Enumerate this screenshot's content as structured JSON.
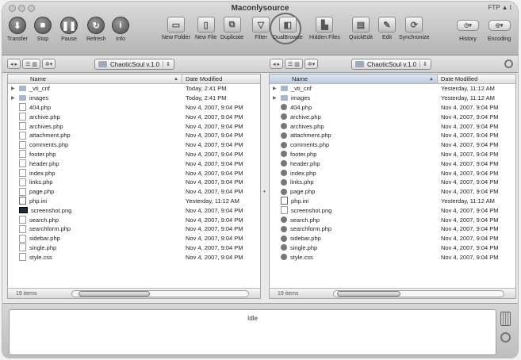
{
  "window": {
    "title": "Maconlysource",
    "ftp_badge": "FTP ▲ t"
  },
  "toolbar": {
    "transfer": "Transfer",
    "stop": "Stop",
    "pause": "Pause",
    "refresh": "Refresh",
    "info": "Info",
    "new_folder": "New Folder",
    "new_file": "New File",
    "duplicate": "Duplicate",
    "filter": "Filter",
    "dual_browse": "DualBrowse",
    "hidden_files": "Hidden Files",
    "quickedit": "QuickEdit",
    "edit": "Edit",
    "synchronize": "Synchronize",
    "history": "History",
    "encoding": "Encoding"
  },
  "icons": {
    "transfer": "down-arrow-icon",
    "stop": "stop-icon",
    "pause": "pause-icon",
    "refresh": "refresh-icon",
    "info": "info-icon",
    "new_folder": "new-folder-icon",
    "new_file": "new-file-icon",
    "duplicate": "duplicate-icon",
    "filter": "filter-icon",
    "dual_browse": "dual-browse-icon",
    "hidden_files": "hidden-files-icon",
    "quickedit": "quickedit-icon",
    "edit": "edit-icon",
    "synchronize": "synchronize-icon"
  },
  "left": {
    "path": "ChaoticSoul v.1.0",
    "header": {
      "name": "Name",
      "date": "Date Modified"
    },
    "items_count": "19 items",
    "rows": [
      {
        "name": "_vti_cnf",
        "date": "Today, 2:41 PM",
        "kind": "folder"
      },
      {
        "name": "images",
        "date": "Today, 2:41 PM",
        "kind": "folder"
      },
      {
        "name": "404.php",
        "date": "Nov 4, 2007, 9:04 PM",
        "kind": "php"
      },
      {
        "name": "archive.php",
        "date": "Nov 4, 2007, 9:04 PM",
        "kind": "php"
      },
      {
        "name": "archives.php",
        "date": "Nov 4, 2007, 9:04 PM",
        "kind": "php"
      },
      {
        "name": "attachment.php",
        "date": "Nov 4, 2007, 9:04 PM",
        "kind": "php"
      },
      {
        "name": "comments.php",
        "date": "Nov 4, 2007, 9:04 PM",
        "kind": "php"
      },
      {
        "name": "footer.php",
        "date": "Nov 4, 2007, 9:04 PM",
        "kind": "php"
      },
      {
        "name": "header.php",
        "date": "Nov 4, 2007, 9:04 PM",
        "kind": "php"
      },
      {
        "name": "index.php",
        "date": "Nov 4, 2007, 9:04 PM",
        "kind": "php"
      },
      {
        "name": "links.php",
        "date": "Nov 4, 2007, 9:04 PM",
        "kind": "php"
      },
      {
        "name": "page.php",
        "date": "Nov 4, 2007, 9:04 PM",
        "kind": "php"
      },
      {
        "name": "php.ini",
        "date": "Yesterday, 11:12 AM",
        "kind": "ini"
      },
      {
        "name": "screenshot.png",
        "date": "Nov 4, 2007, 9:04 PM",
        "kind": "image"
      },
      {
        "name": "search.php",
        "date": "Nov 4, 2007, 9:04 PM",
        "kind": "php"
      },
      {
        "name": "searchform.php",
        "date": "Nov 4, 2007, 9:04 PM",
        "kind": "php"
      },
      {
        "name": "sidebar.php",
        "date": "Nov 4, 2007, 9:04 PM",
        "kind": "php"
      },
      {
        "name": "single.php",
        "date": "Nov 4, 2007, 9:04 PM",
        "kind": "php"
      },
      {
        "name": "style.css",
        "date": "Nov 4, 2007, 9:04 PM",
        "kind": "php"
      }
    ]
  },
  "right": {
    "path": "ChaoticSoul v.1.0",
    "header": {
      "name": "Name",
      "date": "Date Modified"
    },
    "items_count": "19 items",
    "rows": [
      {
        "name": "_vti_cnf",
        "date": "Yesterday, 11:12 AM",
        "kind": "folder"
      },
      {
        "name": "images",
        "date": "Yesterday, 11:12 AM",
        "kind": "folder"
      },
      {
        "name": "404.php",
        "date": "Nov 4, 2007, 9:04 PM",
        "kind": "phpsel"
      },
      {
        "name": "archive.php",
        "date": "Nov 4, 2007, 9:04 PM",
        "kind": "phpsel"
      },
      {
        "name": "archives.php",
        "date": "Nov 4, 2007, 9:04 PM",
        "kind": "phpsel"
      },
      {
        "name": "attachment.php",
        "date": "Nov 4, 2007, 9:04 PM",
        "kind": "phpsel"
      },
      {
        "name": "comments.php",
        "date": "Nov 4, 2007, 9:04 PM",
        "kind": "phpsel"
      },
      {
        "name": "footer.php",
        "date": "Nov 4, 2007, 9:04 PM",
        "kind": "phpsel"
      },
      {
        "name": "header.php",
        "date": "Nov 4, 2007, 9:04 PM",
        "kind": "phpsel"
      },
      {
        "name": "index.php",
        "date": "Nov 4, 2007, 9:04 PM",
        "kind": "phpsel"
      },
      {
        "name": "links.php",
        "date": "Nov 4, 2007, 9:04 PM",
        "kind": "phpsel"
      },
      {
        "name": "page.php",
        "date": "Nov 4, 2007, 9:04 PM",
        "kind": "phpsel"
      },
      {
        "name": "php.ini",
        "date": "Yesterday, 11:12 AM",
        "kind": "ini"
      },
      {
        "name": "screenshot.png",
        "date": "Nov 4, 2007, 9:04 PM",
        "kind": "file"
      },
      {
        "name": "search.php",
        "date": "Nov 4, 2007, 9:04 PM",
        "kind": "phpsel"
      },
      {
        "name": "searchform.php",
        "date": "Nov 4, 2007, 9:04 PM",
        "kind": "phpsel"
      },
      {
        "name": "sidebar.php",
        "date": "Nov 4, 2007, 9:04 PM",
        "kind": "phpsel"
      },
      {
        "name": "single.php",
        "date": "Nov 4, 2007, 9:04 PM",
        "kind": "phpsel"
      },
      {
        "name": "style.css",
        "date": "Nov 4, 2007, 9:04 PM",
        "kind": "phpsel"
      }
    ]
  },
  "transfer": {
    "status": "Idle"
  }
}
